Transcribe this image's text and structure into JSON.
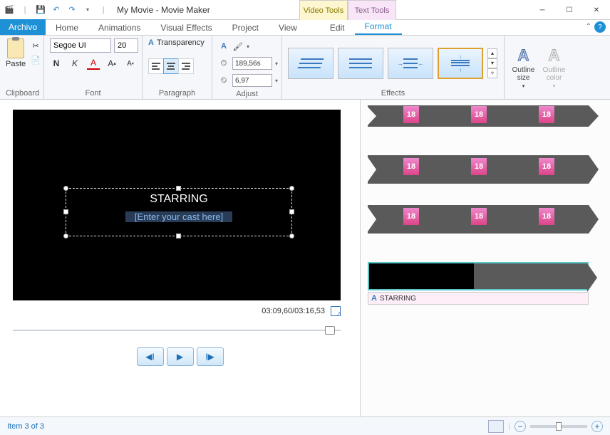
{
  "title": "My Movie - Movie Maker",
  "context_tabs": {
    "video": "Video Tools",
    "text": "Text Tools"
  },
  "tabs": {
    "file": "Archivo",
    "home": "Home",
    "animations": "Animations",
    "visual_effects": "Visual Effects",
    "project": "Project",
    "view": "View",
    "edit": "Edit",
    "format": "Format"
  },
  "ribbon": {
    "clipboard": {
      "paste": "Paste",
      "label": "Clipboard"
    },
    "font": {
      "family": "Segoe UI",
      "size": "20",
      "transparency": "Transparency",
      "label": "Font"
    },
    "paragraph": {
      "label": "Paragraph"
    },
    "adjust": {
      "duration_value": "189,56s",
      "start_value": "6,97",
      "label": "Adjust"
    },
    "effects": {
      "label": "Effects"
    },
    "outline": {
      "size": "Outline size",
      "color": "Outline color"
    }
  },
  "preview": {
    "title_text": "STARRING",
    "placeholder": "[Enter your cast here]",
    "time": "03:09,60/03:16,53"
  },
  "timeline": {
    "badge": "18",
    "caption": "STARRING"
  },
  "status": {
    "item": "Item 3 of 3"
  }
}
